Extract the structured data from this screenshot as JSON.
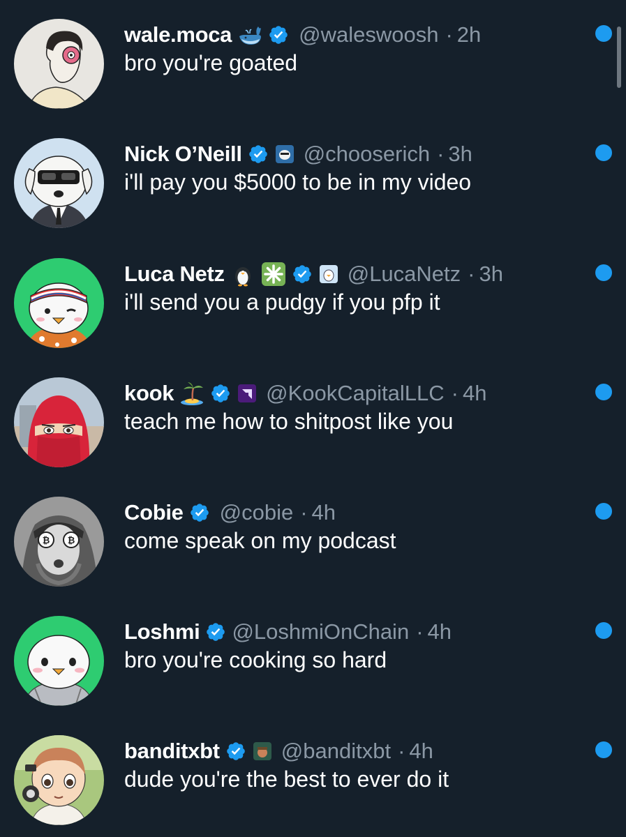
{
  "colors": {
    "background": "#15202b",
    "name_text": "#ffffff",
    "meta_text": "#8b98a5",
    "verified_blue": "#1d9bf0",
    "unread_dot": "#1d9bf0"
  },
  "conversations": [
    {
      "name": "wale.moca",
      "emoji": "whale-emoji",
      "verified": true,
      "affiliate": null,
      "handle": "@waleswoosh",
      "time": "2h",
      "message": "bro you're goated",
      "unread": true
    },
    {
      "name": "Nick O’Neill",
      "emoji": null,
      "verified": true,
      "affiliate": "affiliate-badge",
      "handle": "@chooserich",
      "time": "3h",
      "message": "i'll pay you $5000 to be in my video",
      "unread": true
    },
    {
      "name": "Luca Netz",
      "emoji": "penguin-emoji, sparkle-emoji",
      "verified": true,
      "affiliate": "affiliate-badge",
      "handle": "@LucaNetz",
      "time": "3h",
      "message": "i'll send you a pudgy if you pfp it",
      "unread": true
    },
    {
      "name": "kook",
      "emoji": "island-emoji",
      "verified": true,
      "affiliate": "affiliate-badge",
      "handle": "@KookCapitalLLC",
      "time": "4h",
      "message": "teach me how to shitpost like you",
      "unread": true
    },
    {
      "name": "Cobie",
      "emoji": null,
      "verified": true,
      "affiliate": null,
      "handle": "@cobie",
      "time": "4h",
      "message": "come speak on my podcast",
      "unread": true
    },
    {
      "name": "Loshmi",
      "emoji": null,
      "verified": true,
      "affiliate": null,
      "handle": "@LoshmiOnChain",
      "time": "4h",
      "message": "bro you're cooking so hard",
      "unread": true
    },
    {
      "name": "banditxbt",
      "emoji": null,
      "verified": true,
      "affiliate": "affiliate-badge",
      "handle": "@banditxbt",
      "time": "4h",
      "message": "dude you're the best to ever do it",
      "unread": true
    }
  ],
  "separator": "·"
}
